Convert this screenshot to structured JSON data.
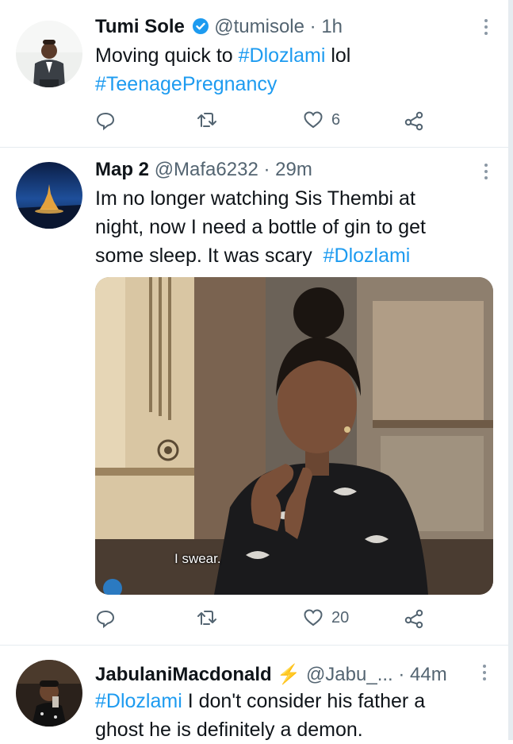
{
  "tweets": [
    {
      "name": "Tumi Sole",
      "verified": true,
      "handle": "@tumisole",
      "sep": "·",
      "time": "1h",
      "lines": [
        [
          {
            "t": "Moving quick to ",
            "h": false
          },
          {
            "t": "#Dlozlami",
            "h": true
          },
          {
            "t": " lol",
            "h": false
          }
        ],
        [
          {
            "t": "#TeenagePregnancy",
            "h": true
          }
        ]
      ],
      "likes": "6",
      "retweets": ""
    },
    {
      "name": "Map 2",
      "handle": "@Mafa6232",
      "sep": "·",
      "time": "29m",
      "lines": [
        [
          {
            "t": "Im no longer watching Sis Thembi at",
            "h": false
          }
        ],
        [
          {
            "t": "night, now I need a bottle of gin to get",
            "h": false
          }
        ],
        [
          {
            "t": "some sleep. It was scary  ",
            "h": false
          },
          {
            "t": "#Dlozlami",
            "h": true
          }
        ]
      ],
      "media_caption": "I swear.",
      "likes": "20",
      "retweets": ""
    },
    {
      "name": "JabulaniMacdonald",
      "badge": "⚡",
      "handle": "@Jabu_...",
      "sep": "·",
      "time": "44m",
      "lines": [
        [
          {
            "t": "#Dlozlami",
            "h": true
          },
          {
            "t": " I don't consider his father a",
            "h": false
          }
        ],
        [
          {
            "t": "ghost he is definitely a demon.",
            "h": false
          }
        ]
      ]
    }
  ],
  "icons": {
    "reply": "reply-icon",
    "retweet": "retweet-icon",
    "like": "heart-icon",
    "share": "share-icon",
    "more": "more-icon",
    "verified": "verified-badge-icon"
  },
  "colors": {
    "hashtag": "#1d9bf0",
    "secondary_text": "#536471",
    "verified": "#1d9bf0",
    "lightning": "#f9b43a",
    "divider": "#e6ecf0"
  }
}
